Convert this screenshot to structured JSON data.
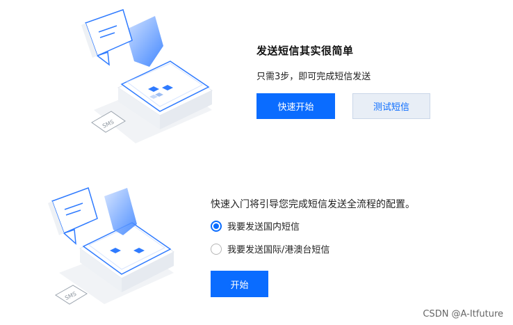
{
  "top_section": {
    "title": "发送短信其实很简单",
    "subtitle": "只需3步，即可完成短信发送",
    "quick_start_label": "快速开始",
    "test_sms_label": "测试短信",
    "illustration": {
      "icons": [
        "chat-bubble-icon",
        "sms-card-icon",
        "platform-icon"
      ],
      "sms_tag": "SMS"
    }
  },
  "bottom_section": {
    "description": "快速入门将引导您完成短信发送全流程的配置。",
    "options": [
      {
        "label": "我要发送国内短信",
        "checked": true
      },
      {
        "label": "我要发送国际/港澳台短信",
        "checked": false
      }
    ],
    "start_label": "开始",
    "illustration": {
      "icons": [
        "chat-bubble-icon",
        "sms-card-icon",
        "platform-icon"
      ],
      "sms_tag": "SMS"
    }
  },
  "watermark": "CSDN @A-Itfuture",
  "colors": {
    "primary": "#0a6cff",
    "secondary_bg": "#e8eef6",
    "text": "#222222"
  }
}
